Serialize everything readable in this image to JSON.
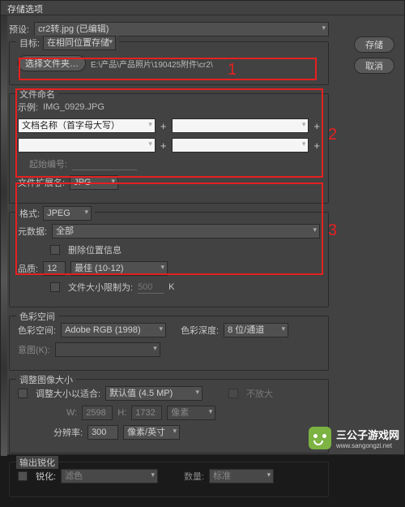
{
  "window": {
    "title": "存储选项"
  },
  "preset": {
    "label": "预设:",
    "value": "cr2转.jpg (已编辑)"
  },
  "buttons": {
    "save": "存储",
    "cancel": "取消"
  },
  "target": {
    "legend": "目标:",
    "value": "在相同位置存储",
    "pick_folder_btn": "选择文件夹…",
    "path": "E:\\产品\\产品照片\\190425附件\\cr2\\"
  },
  "filename": {
    "legend": "文件命名",
    "example_label": "示例:",
    "example_value": "IMG_0929.JPG",
    "seg1": "文档名称（首字母大写）",
    "seg2": "",
    "seg3": "",
    "seg4": "",
    "start_label": "起始编号:",
    "start_value": "",
    "ext_label": "文件扩展名:",
    "ext_value": "JPG"
  },
  "format": {
    "legend": "格式:",
    "value": "JPEG",
    "metadata_label": "元数据:",
    "metadata_value": "全部",
    "remove_location": "删除位置信息",
    "quality_label": "品质:",
    "quality_num": "12",
    "quality_preset": "最佳 (10-12)",
    "limit_label": "文件大小限制为:",
    "limit_value": "500",
    "limit_unit": "K"
  },
  "colorspace": {
    "legend": "色彩空间",
    "space_label": "色彩空间:",
    "space_value": "Adobe RGB (1998)",
    "depth_label": "色彩深度:",
    "depth_value": "8 位/通道",
    "intent_label": "意图(K):",
    "intent_value": ""
  },
  "resize": {
    "legend": "调整图像大小",
    "fit_label": "调整大小以适合:",
    "fit_value": "默认值 (4.5 MP)",
    "no_enlarge": "不放大",
    "w_label": "W:",
    "w_value": "2598",
    "h_label": "H:",
    "h_value": "1732",
    "unit": "像素",
    "res_label": "分辨率:",
    "res_value": "300",
    "res_unit": "像素/英寸"
  },
  "sharpen": {
    "legend": "输出锐化",
    "enable_label": "锐化:",
    "for_value": "滤色",
    "amount_label": "数量:",
    "amount_value": "标准"
  },
  "annotations": {
    "n1": "1",
    "n2": "2",
    "n3": "3"
  },
  "watermark": {
    "brand": "三公子游戏网",
    "url": "www.sangongzi.net"
  }
}
